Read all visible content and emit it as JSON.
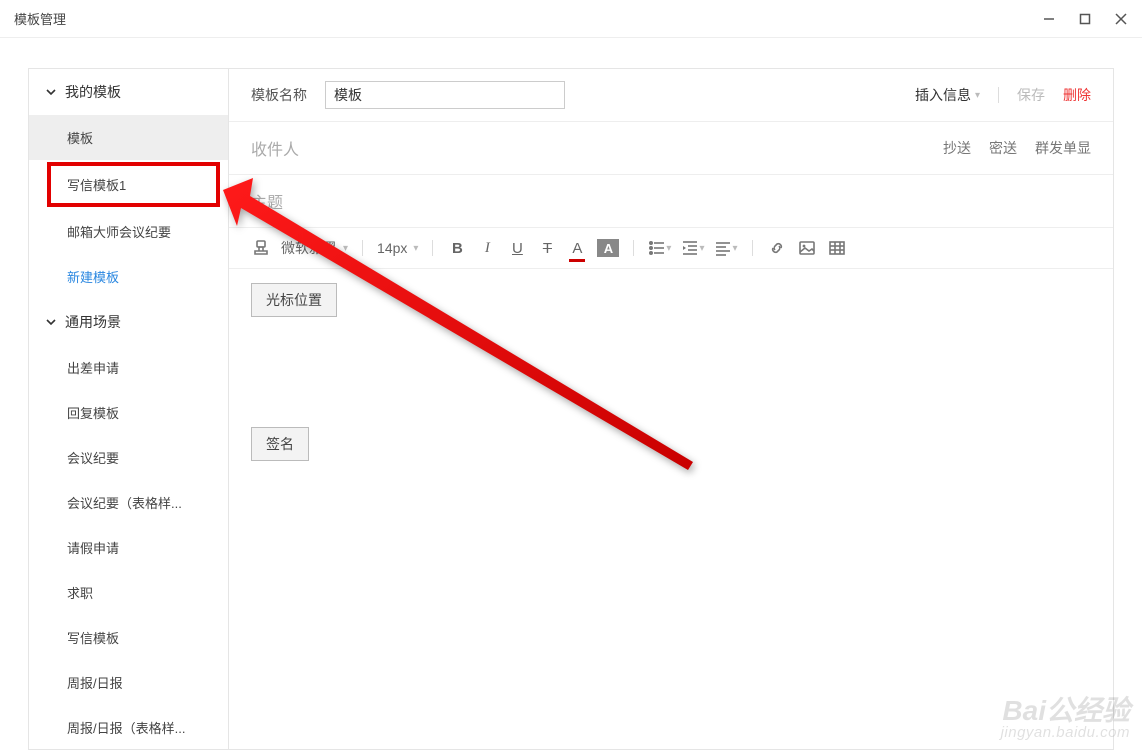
{
  "window": {
    "title": "模板管理"
  },
  "sidebar": {
    "groups": [
      {
        "label": "我的模板",
        "items": [
          {
            "label": "模板",
            "selected": true
          },
          {
            "label": "写信模板1",
            "highlighted": true
          },
          {
            "label": "邮箱大师会议纪要"
          }
        ],
        "new_link": "新建模板"
      },
      {
        "label": "通用场景",
        "items": [
          {
            "label": "出差申请"
          },
          {
            "label": "回复模板"
          },
          {
            "label": "会议纪要"
          },
          {
            "label": "会议纪要（表格样..."
          },
          {
            "label": "请假申请"
          },
          {
            "label": "求职"
          },
          {
            "label": "写信模板"
          },
          {
            "label": "周报/日报"
          },
          {
            "label": "周报/日报（表格样..."
          }
        ]
      }
    ]
  },
  "editor": {
    "name_label": "模板名称",
    "name_value": "模板",
    "insert_info": "插入信息",
    "save": "保存",
    "delete": "删除",
    "recipient_label": "收件人",
    "cc": "抄送",
    "bcc": "密送",
    "mass": "群发单显",
    "subject_label": "主题",
    "toolbar": {
      "font_family": "微软雅黑",
      "font_size": "14px",
      "bold": "B",
      "italic": "I",
      "under": "U",
      "strike": "T",
      "color": "A",
      "bg": "A"
    },
    "placeholder_button": "光标位置",
    "signature_button": "签名"
  },
  "watermark": {
    "main": "Bai公经验",
    "sub": "jingyan.baidu.com"
  }
}
